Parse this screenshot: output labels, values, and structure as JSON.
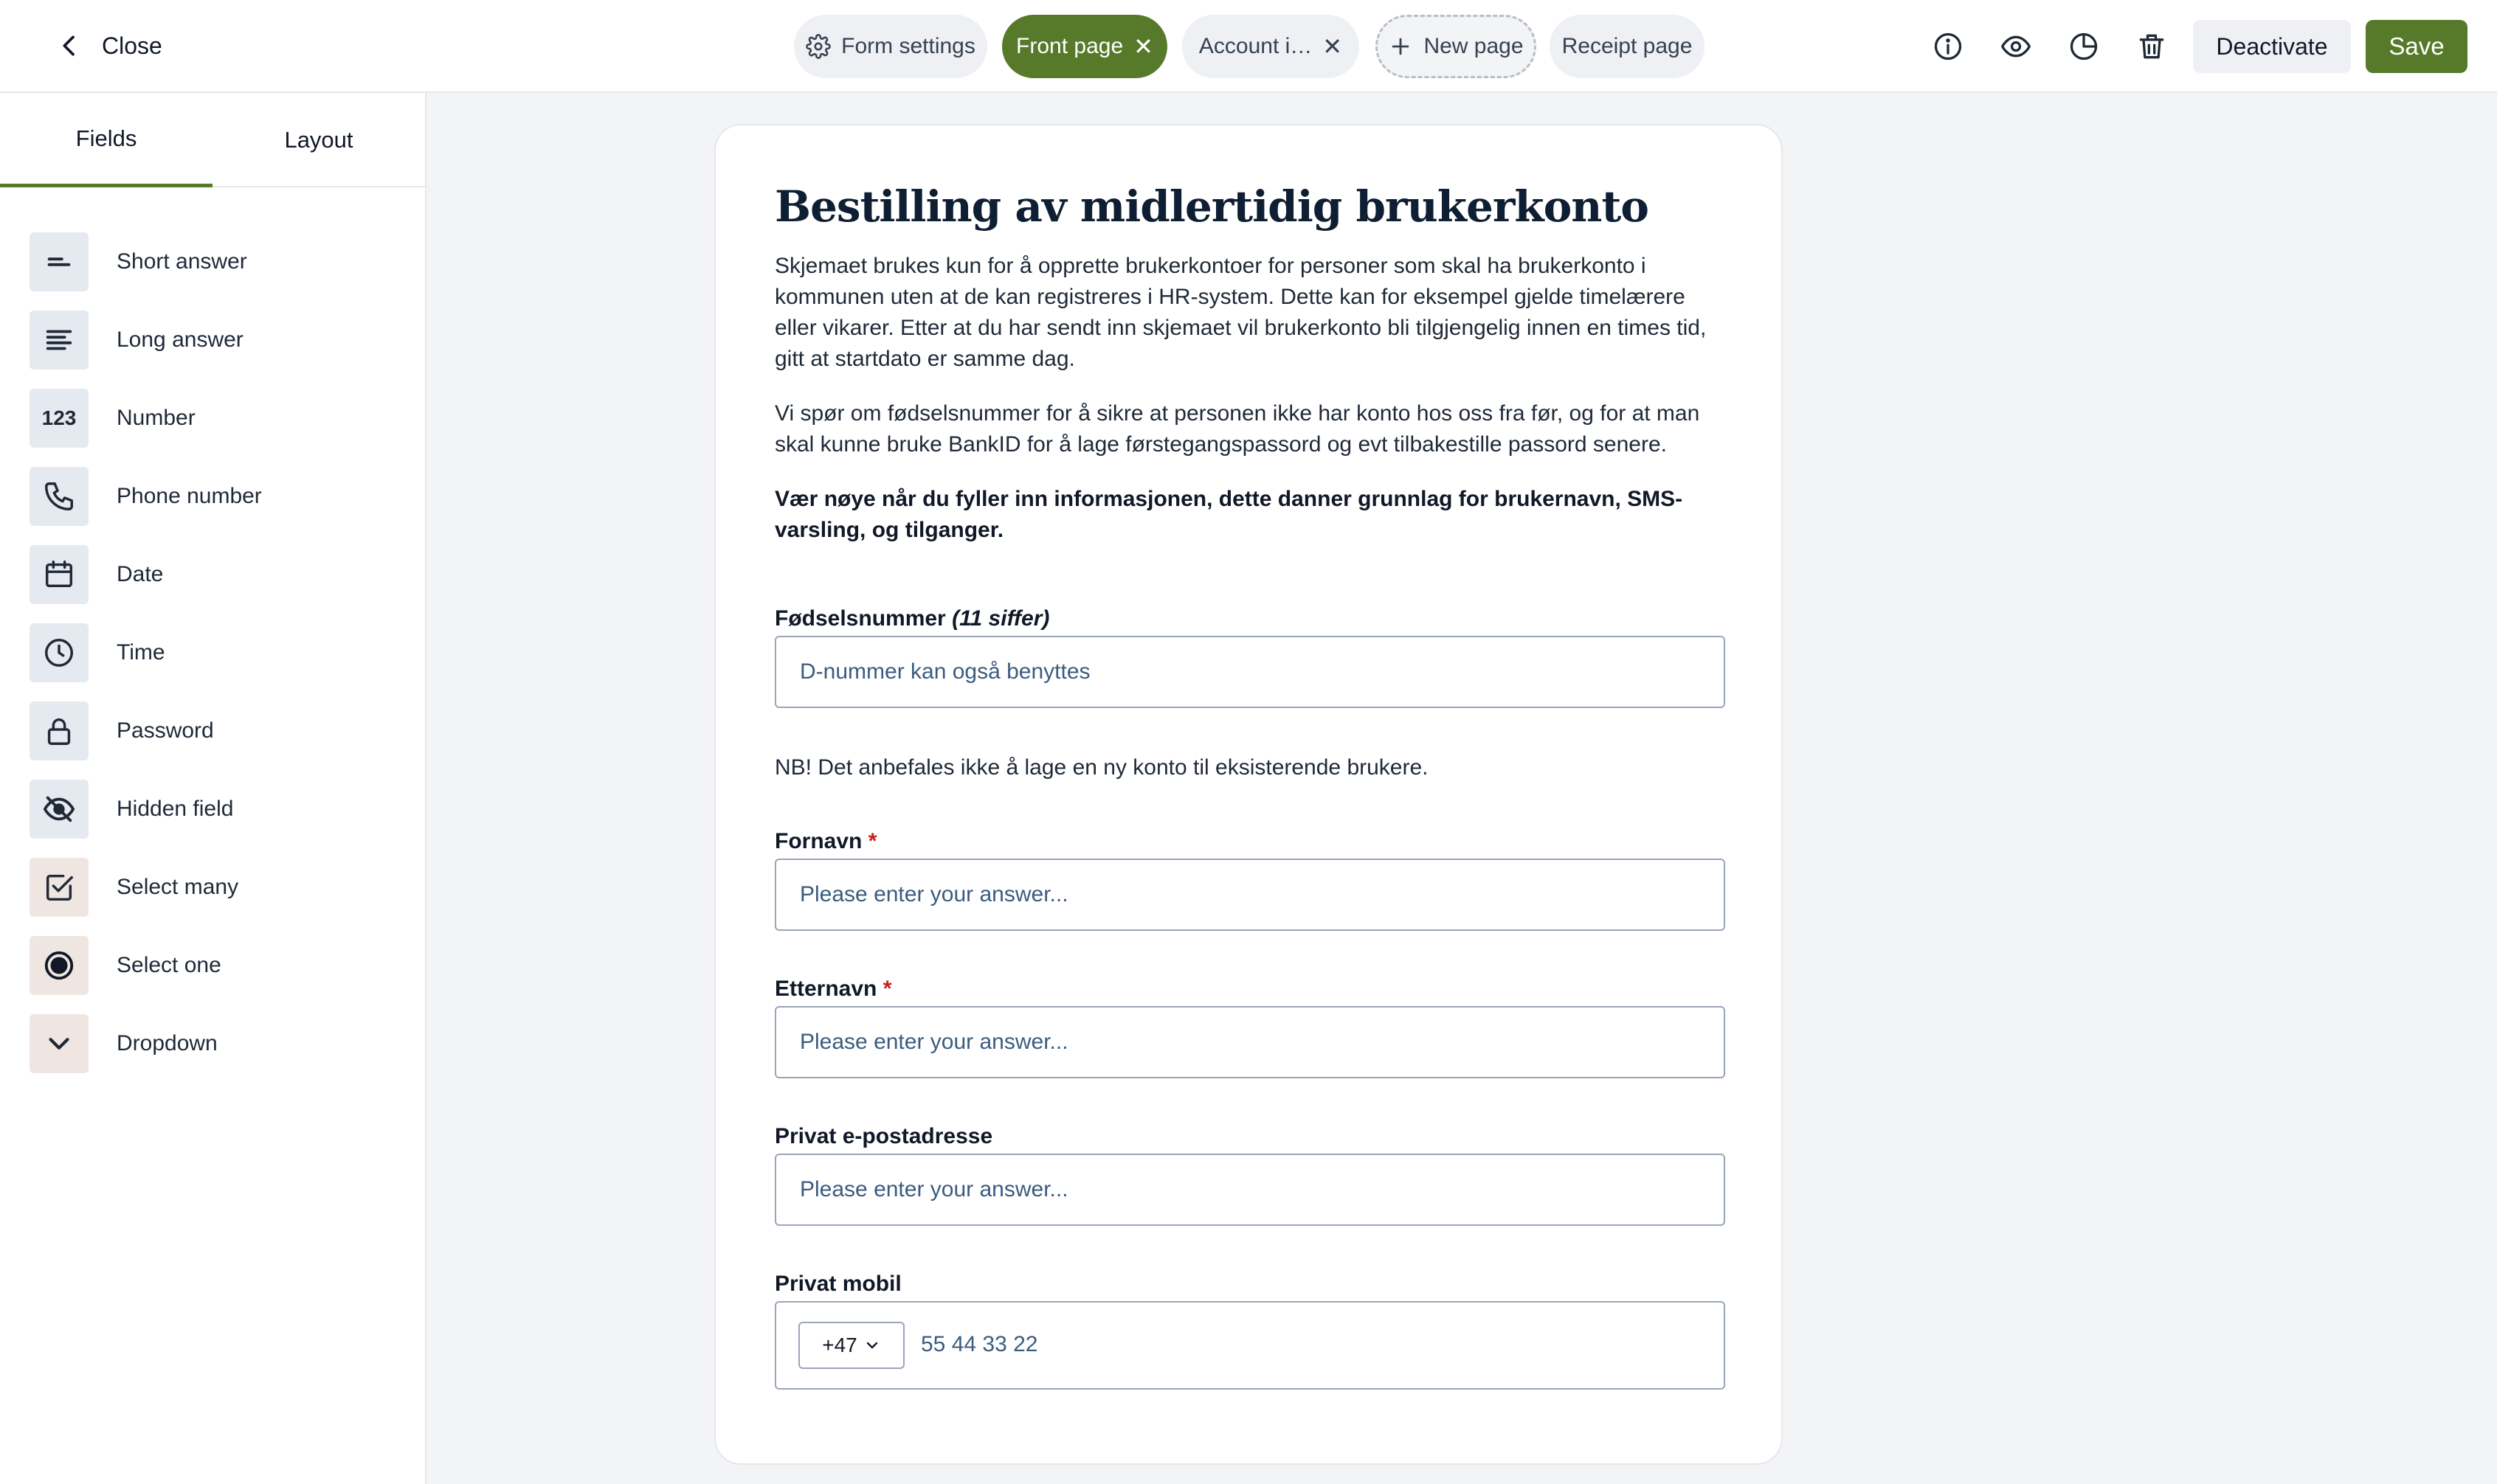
{
  "header": {
    "close_label": "Close",
    "tabs": [
      {
        "label": "Form settings",
        "icon": "gear-icon",
        "active": false
      },
      {
        "label": "Front page",
        "active": true,
        "closable": true
      },
      {
        "label": "Account i…",
        "active": false,
        "closable": true
      },
      {
        "label": "New page",
        "icon": "plus-icon",
        "style": "dashed"
      },
      {
        "label": "Receipt page",
        "active": false
      }
    ],
    "icons": [
      "info-icon",
      "eye-icon",
      "pie-chart-icon",
      "trash-icon"
    ],
    "deactivate_label": "Deactivate",
    "save_label": "Save",
    "accent_color": "#577a2a"
  },
  "sidebar": {
    "tabs": [
      {
        "label": "Fields",
        "active": true
      },
      {
        "label": "Layout",
        "active": false
      }
    ],
    "fields": [
      {
        "label": "Short answer",
        "icon": "short-answer-icon"
      },
      {
        "label": "Long answer",
        "icon": "long-answer-icon"
      },
      {
        "label": "Number",
        "icon_text": "123"
      },
      {
        "label": "Phone number",
        "icon": "phone-icon"
      },
      {
        "label": "Date",
        "icon": "calendar-icon"
      },
      {
        "label": "Time",
        "icon": "clock-icon"
      },
      {
        "label": "Password",
        "icon": "lock-icon"
      },
      {
        "label": "Hidden field",
        "icon": "eye-off-icon"
      },
      {
        "label": "Select many",
        "icon": "checkbox-icon"
      },
      {
        "label": "Select one",
        "icon": "radio-icon"
      },
      {
        "label": "Dropdown",
        "icon": "chevron-down-icon"
      }
    ]
  },
  "form": {
    "title": "Bestilling av midlertidig brukerkonto",
    "intro_1": "Skjemaet brukes kun for å opprette brukerkontoer for personer som skal ha brukerkonto i kommunen uten at de kan registreres i HR-system. Dette kan for eksempel gjelde  timelærere eller vikarer. Etter at du har sendt inn skjemaet vil brukerkonto bli tilgjengelig innen en times tid, gitt at startdato er samme dag.",
    "intro_2": "Vi spør om fødselsnummer for å sikre at personen ikke har konto hos oss fra før, og for at man skal kunne bruke BankID for å lage førstegangspassord og evt tilbakestille passord senere.",
    "intro_3": "Vær nøye når du fyller inn informasjonen, dette danner grunnlag for brukernavn, SMS-varsling, og tilganger.",
    "ssn": {
      "label": "Fødselsnummer",
      "hint": "(11 siffer)",
      "placeholder": "D-nummer kan også benyttes"
    },
    "note": "NB! Det anbefales ikke å lage en ny konto til eksisterende brukere.",
    "first_name": {
      "label": "Fornavn",
      "required_mark": "*",
      "placeholder": "Please enter your answer..."
    },
    "last_name": {
      "label": "Etternavn",
      "required_mark": "*",
      "placeholder": "Please enter your answer..."
    },
    "email": {
      "label": "Privat e-postadresse",
      "placeholder": "Please enter your answer..."
    },
    "mobile": {
      "label": "Privat mobil",
      "country_code": "+47",
      "placeholder": "55 44 33 22"
    }
  }
}
